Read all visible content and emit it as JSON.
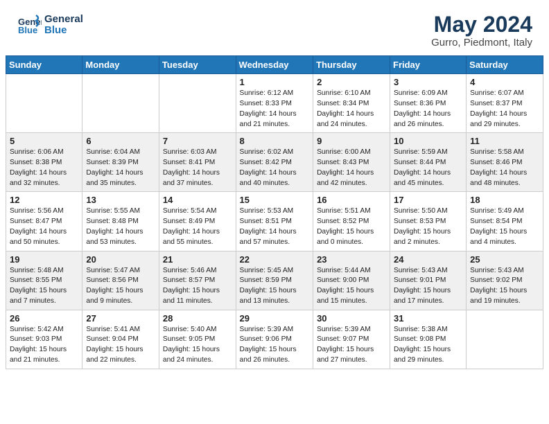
{
  "header": {
    "logo_line1": "General",
    "logo_line2": "Blue",
    "month_year": "May 2024",
    "location": "Gurro, Piedmont, Italy"
  },
  "weekdays": [
    "Sunday",
    "Monday",
    "Tuesday",
    "Wednesday",
    "Thursday",
    "Friday",
    "Saturday"
  ],
  "weeks": [
    [
      {
        "day": "",
        "text": ""
      },
      {
        "day": "",
        "text": ""
      },
      {
        "day": "",
        "text": ""
      },
      {
        "day": "1",
        "text": "Sunrise: 6:12 AM\nSunset: 8:33 PM\nDaylight: 14 hours and 21 minutes."
      },
      {
        "day": "2",
        "text": "Sunrise: 6:10 AM\nSunset: 8:34 PM\nDaylight: 14 hours and 24 minutes."
      },
      {
        "day": "3",
        "text": "Sunrise: 6:09 AM\nSunset: 8:36 PM\nDaylight: 14 hours and 26 minutes."
      },
      {
        "day": "4",
        "text": "Sunrise: 6:07 AM\nSunset: 8:37 PM\nDaylight: 14 hours and 29 minutes."
      }
    ],
    [
      {
        "day": "5",
        "text": "Sunrise: 6:06 AM\nSunset: 8:38 PM\nDaylight: 14 hours and 32 minutes."
      },
      {
        "day": "6",
        "text": "Sunrise: 6:04 AM\nSunset: 8:39 PM\nDaylight: 14 hours and 35 minutes."
      },
      {
        "day": "7",
        "text": "Sunrise: 6:03 AM\nSunset: 8:41 PM\nDaylight: 14 hours and 37 minutes."
      },
      {
        "day": "8",
        "text": "Sunrise: 6:02 AM\nSunset: 8:42 PM\nDaylight: 14 hours and 40 minutes."
      },
      {
        "day": "9",
        "text": "Sunrise: 6:00 AM\nSunset: 8:43 PM\nDaylight: 14 hours and 42 minutes."
      },
      {
        "day": "10",
        "text": "Sunrise: 5:59 AM\nSunset: 8:44 PM\nDaylight: 14 hours and 45 minutes."
      },
      {
        "day": "11",
        "text": "Sunrise: 5:58 AM\nSunset: 8:46 PM\nDaylight: 14 hours and 48 minutes."
      }
    ],
    [
      {
        "day": "12",
        "text": "Sunrise: 5:56 AM\nSunset: 8:47 PM\nDaylight: 14 hours and 50 minutes."
      },
      {
        "day": "13",
        "text": "Sunrise: 5:55 AM\nSunset: 8:48 PM\nDaylight: 14 hours and 53 minutes."
      },
      {
        "day": "14",
        "text": "Sunrise: 5:54 AM\nSunset: 8:49 PM\nDaylight: 14 hours and 55 minutes."
      },
      {
        "day": "15",
        "text": "Sunrise: 5:53 AM\nSunset: 8:51 PM\nDaylight: 14 hours and 57 minutes."
      },
      {
        "day": "16",
        "text": "Sunrise: 5:51 AM\nSunset: 8:52 PM\nDaylight: 15 hours and 0 minutes."
      },
      {
        "day": "17",
        "text": "Sunrise: 5:50 AM\nSunset: 8:53 PM\nDaylight: 15 hours and 2 minutes."
      },
      {
        "day": "18",
        "text": "Sunrise: 5:49 AM\nSunset: 8:54 PM\nDaylight: 15 hours and 4 minutes."
      }
    ],
    [
      {
        "day": "19",
        "text": "Sunrise: 5:48 AM\nSunset: 8:55 PM\nDaylight: 15 hours and 7 minutes."
      },
      {
        "day": "20",
        "text": "Sunrise: 5:47 AM\nSunset: 8:56 PM\nDaylight: 15 hours and 9 minutes."
      },
      {
        "day": "21",
        "text": "Sunrise: 5:46 AM\nSunset: 8:57 PM\nDaylight: 15 hours and 11 minutes."
      },
      {
        "day": "22",
        "text": "Sunrise: 5:45 AM\nSunset: 8:59 PM\nDaylight: 15 hours and 13 minutes."
      },
      {
        "day": "23",
        "text": "Sunrise: 5:44 AM\nSunset: 9:00 PM\nDaylight: 15 hours and 15 minutes."
      },
      {
        "day": "24",
        "text": "Sunrise: 5:43 AM\nSunset: 9:01 PM\nDaylight: 15 hours and 17 minutes."
      },
      {
        "day": "25",
        "text": "Sunrise: 5:43 AM\nSunset: 9:02 PM\nDaylight: 15 hours and 19 minutes."
      }
    ],
    [
      {
        "day": "26",
        "text": "Sunrise: 5:42 AM\nSunset: 9:03 PM\nDaylight: 15 hours and 21 minutes."
      },
      {
        "day": "27",
        "text": "Sunrise: 5:41 AM\nSunset: 9:04 PM\nDaylight: 15 hours and 22 minutes."
      },
      {
        "day": "28",
        "text": "Sunrise: 5:40 AM\nSunset: 9:05 PM\nDaylight: 15 hours and 24 minutes."
      },
      {
        "day": "29",
        "text": "Sunrise: 5:39 AM\nSunset: 9:06 PM\nDaylight: 15 hours and 26 minutes."
      },
      {
        "day": "30",
        "text": "Sunrise: 5:39 AM\nSunset: 9:07 PM\nDaylight: 15 hours and 27 minutes."
      },
      {
        "day": "31",
        "text": "Sunrise: 5:38 AM\nSunset: 9:08 PM\nDaylight: 15 hours and 29 minutes."
      },
      {
        "day": "",
        "text": ""
      }
    ]
  ]
}
